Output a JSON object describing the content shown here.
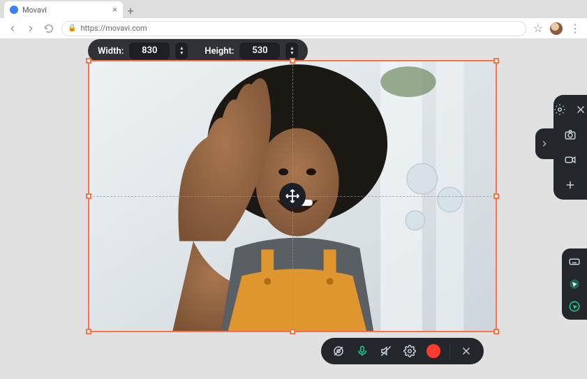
{
  "browser": {
    "tab_title": "Movavi",
    "url": "https://movavi.com"
  },
  "dimensions": {
    "width_label": "Width:",
    "width_value": "830",
    "height_label": "Height:",
    "height_value": "530"
  },
  "icons": {
    "gear": "gear",
    "close": "close",
    "camera": "camera",
    "video": "video",
    "plus": "plus",
    "expand": "chevron-right",
    "keyboard": "keyboard",
    "cursor_highlight": "cursor-highlight",
    "cursor_click": "cursor-click",
    "webcam": "webcam-off",
    "mic": "mic-on",
    "audio": "audio-off",
    "settings": "gear",
    "record": "record",
    "cancel": "close",
    "move": "move"
  },
  "colors": {
    "frame": "#ff7043",
    "panel": "#23262b",
    "accent_green": "#17d39a",
    "record_red": "#ff3b30"
  }
}
